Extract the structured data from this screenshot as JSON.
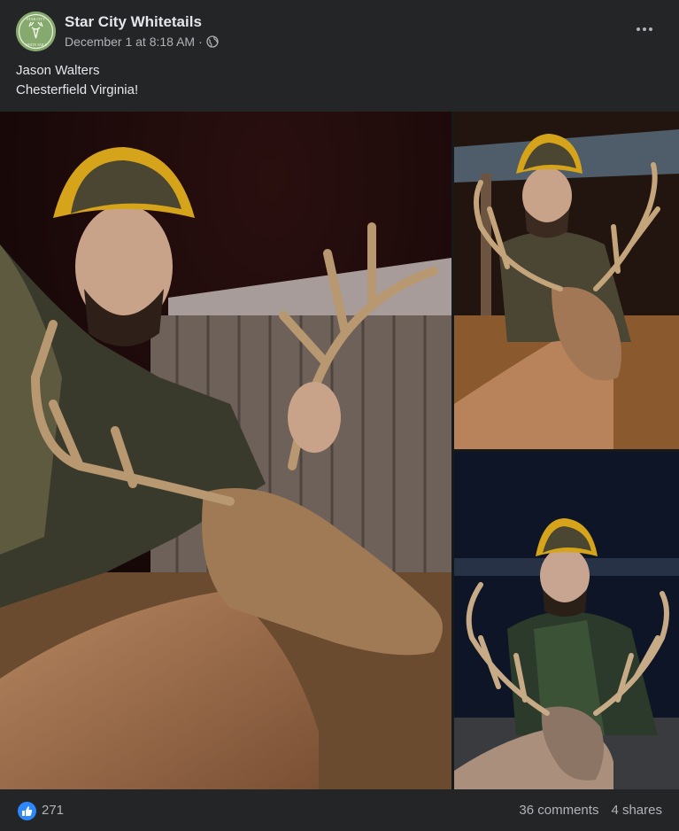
{
  "post": {
    "page_name": "Star City Whitetails",
    "timestamp": "December 1 at 8:18 AM",
    "separator": "·",
    "privacy_icon": "globe-icon",
    "more_icon": "more-options-icon",
    "caption_lines": [
      "Jason Walters",
      "Chesterfield Virginia!"
    ]
  },
  "avatar": {
    "logo_text_top": "STAR CITY",
    "logo_text_bottom": "WHITE TAILS"
  },
  "photos": [
    {
      "name": "photo-main"
    },
    {
      "name": "photo-top-right"
    },
    {
      "name": "photo-bottom-right"
    }
  ],
  "reactions": {
    "icon": "like-icon",
    "count": "271",
    "comments": "36 comments",
    "shares": "4 shares"
  },
  "colors": {
    "background": "#242526",
    "text_primary": "#e4e6eb",
    "text_secondary": "#b0b3b8",
    "like_blue": "#2d88ff"
  }
}
